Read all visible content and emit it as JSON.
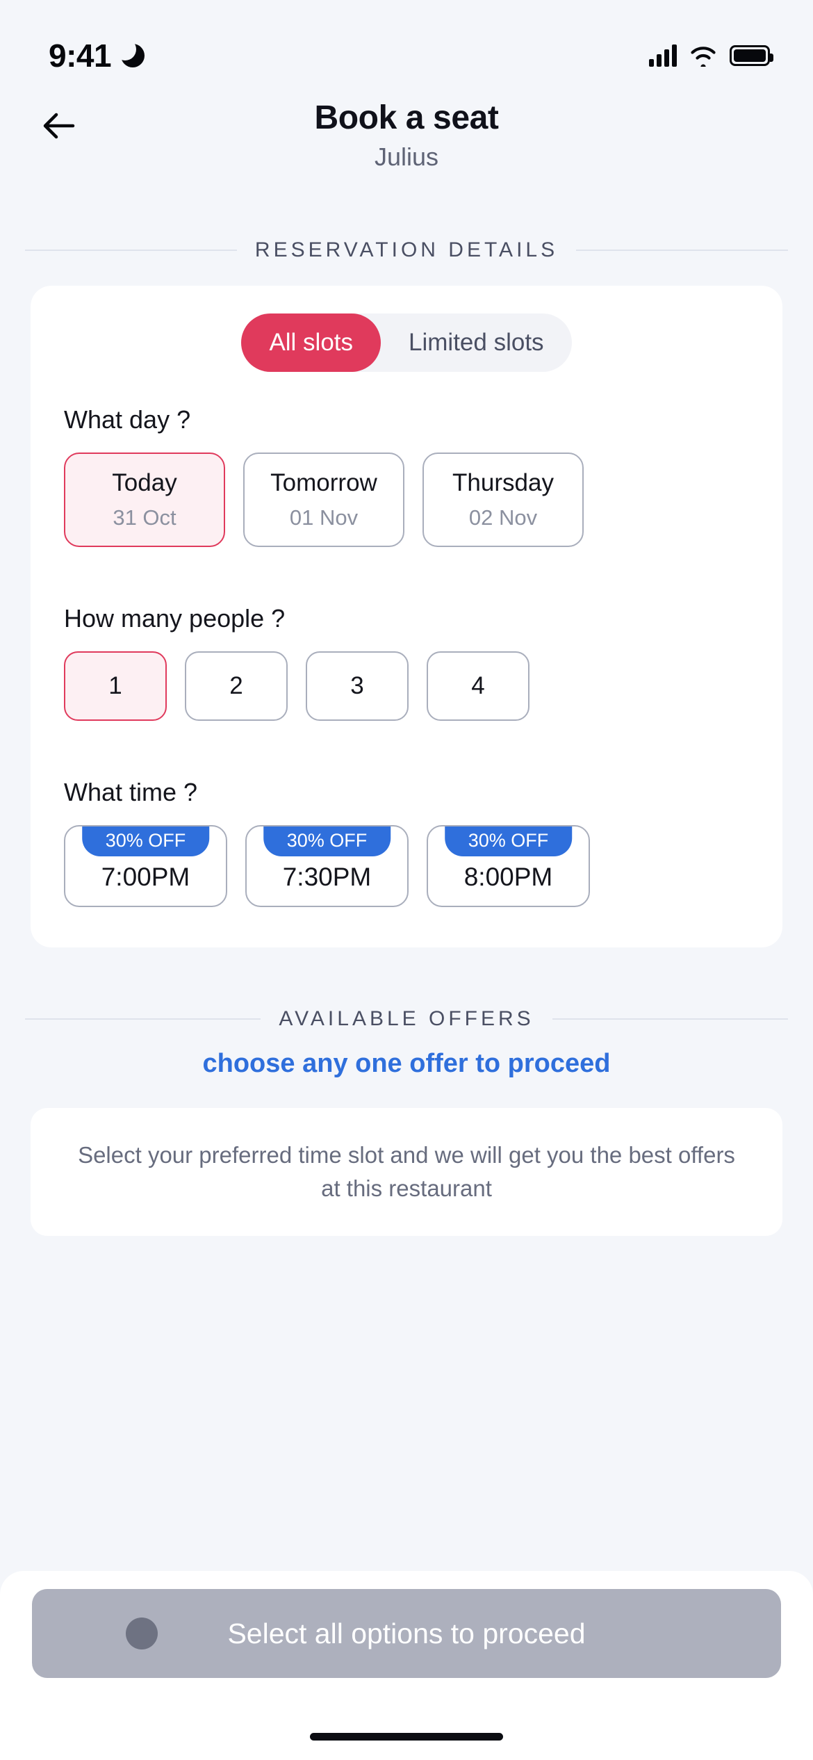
{
  "status_bar": {
    "time": "9:41",
    "dnd_icon": "moon-icon",
    "signal_icon": "cellular-signal-icon",
    "wifi_icon": "wifi-icon",
    "battery_icon": "battery-icon"
  },
  "header": {
    "back_icon": "arrow-left-icon",
    "title": "Book a seat",
    "subtitle": "Julius"
  },
  "reservation_section": {
    "divider_label": "RESERVATION DETAILS",
    "tabs": [
      {
        "label": "All slots",
        "active": true
      },
      {
        "label": "Limited slots",
        "active": false
      }
    ],
    "day_question": "What day ?",
    "days": [
      {
        "name": "Today",
        "date": "31 Oct",
        "selected": true
      },
      {
        "name": "Tomorrow",
        "date": "01 Nov",
        "selected": false
      },
      {
        "name": "Thursday",
        "date": "02 Nov",
        "selected": false
      }
    ],
    "people_question": "How many people ?",
    "people": [
      {
        "count": "1",
        "selected": true
      },
      {
        "count": "2",
        "selected": false
      },
      {
        "count": "3",
        "selected": false
      },
      {
        "count": "4",
        "selected": false
      }
    ],
    "time_question": "What time ?",
    "times": [
      {
        "time": "7:00PM",
        "badge": "30% OFF",
        "selected": false
      },
      {
        "time": "7:30PM",
        "badge": "30% OFF",
        "selected": false
      },
      {
        "time": "8:00PM",
        "badge": "30% OFF",
        "selected": false
      }
    ]
  },
  "offers_section": {
    "divider_label": "AVAILABLE OFFERS",
    "hint": "choose any one offer to proceed",
    "empty_message": "Select your preferred time slot and we will get you the best offers at this restaurant"
  },
  "cta": {
    "label": "Select all options to proceed",
    "enabled": false
  },
  "colors": {
    "accent": "#e03a5c",
    "accent_soft": "#fdf0f3",
    "badge_blue": "#2f6fdc",
    "page_bg": "#f4f6fa",
    "card_bg": "#ffffff",
    "cta_disabled": "#adb0bd"
  }
}
